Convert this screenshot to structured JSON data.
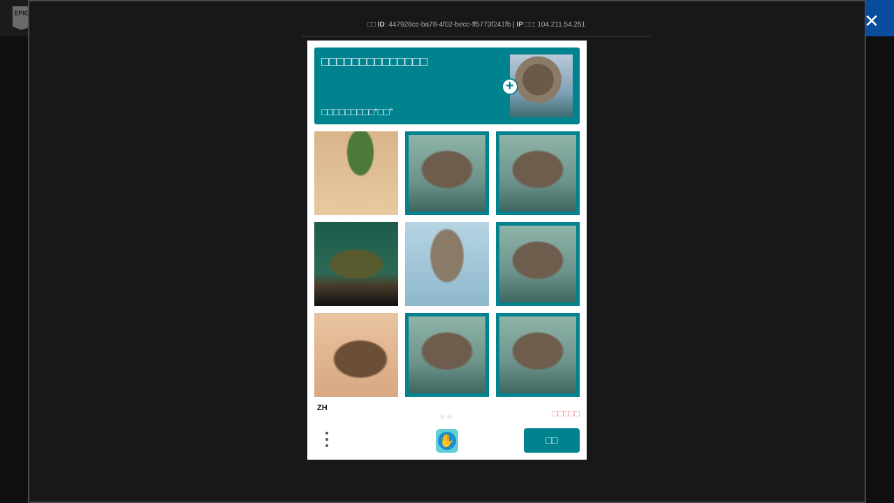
{
  "background": {
    "logo_text": "EPIC GAMES"
  },
  "modal": {
    "meta": {
      "id_prefix": "□□",
      "id_label": "ID",
      "id_value": ": 447928cc-ba78-4f02-becc-ff5773f241fb |",
      "ip_label": "IP",
      "ip_prefix": "□□",
      "ip_value": ": 104.211.54.251"
    },
    "close_icon": "close-icon"
  },
  "captcha": {
    "prompt_title": "□□□□□□□□□□□□□□",
    "prompt_subtitle": "□□□□□□□□□“□□”",
    "example_image": "hedgehog-in-water",
    "tiles": [
      {
        "image": "cactus-on-sand",
        "selected": false
      },
      {
        "image": "hedgehog-in-water",
        "selected": true
      },
      {
        "image": "hedgehog-in-water",
        "selected": true
      },
      {
        "image": "turtle",
        "selected": false
      },
      {
        "image": "rabbit-in-water",
        "selected": false
      },
      {
        "image": "hedgehog-in-water",
        "selected": true
      },
      {
        "image": "hedgehog-on-sand",
        "selected": false
      },
      {
        "image": "hedgehog-in-water",
        "selected": true
      },
      {
        "image": "hedgehog-in-water",
        "selected": true
      }
    ],
    "language": "ZH",
    "report_label": "□□□□□",
    "verify_label": "□□",
    "accent_color": "#00838f"
  }
}
